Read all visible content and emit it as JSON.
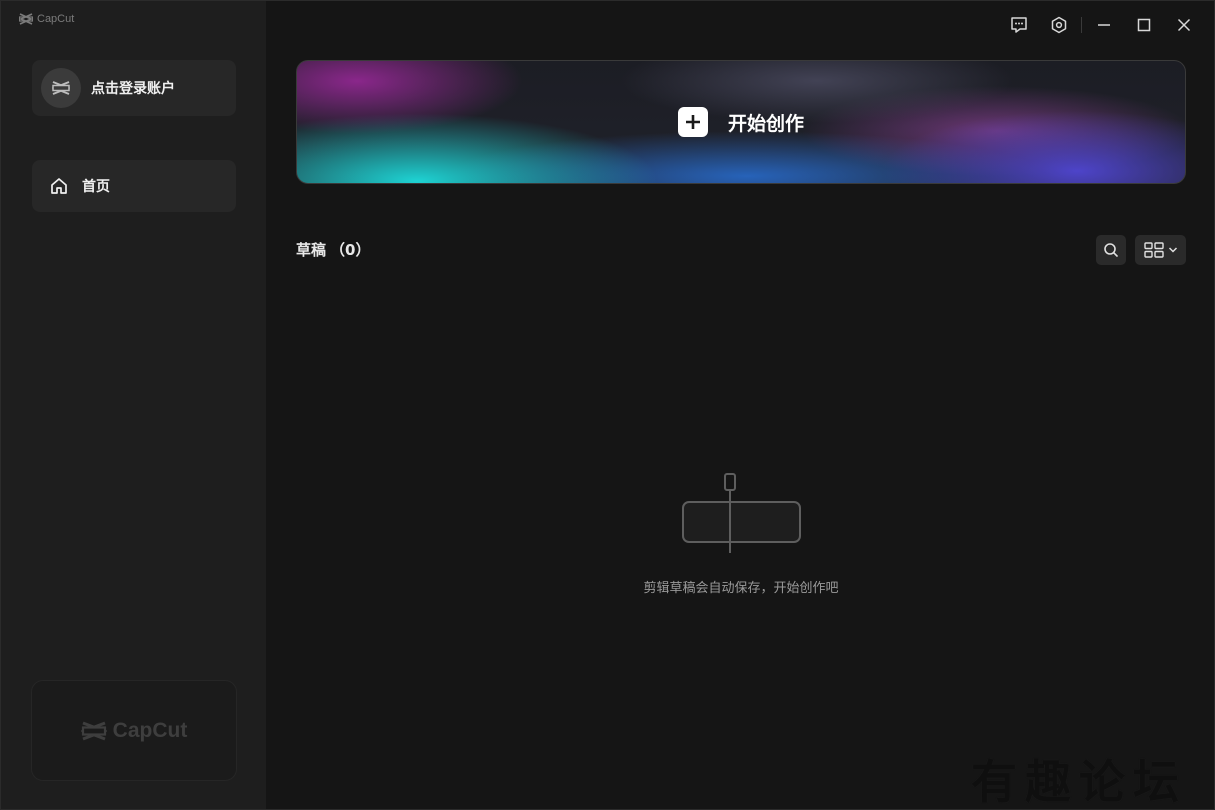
{
  "app": {
    "brand": "CapCut"
  },
  "sidebar": {
    "login_label": "点击登录账户",
    "nav": [
      {
        "label": "首页",
        "icon": "home-icon"
      }
    ],
    "brand_card_text": "CapCut"
  },
  "titlebar": {
    "icons": [
      "feedback-icon",
      "settings-icon",
      "minimize-icon",
      "maximize-icon",
      "close-icon"
    ]
  },
  "main": {
    "create_label": "开始创作",
    "drafts_title": "草稿",
    "drafts_count": "（0）",
    "empty_message": "剪辑草稿会自动保存，开始创作吧"
  },
  "watermark": "有趣论坛",
  "colors": {
    "sidebar_bg": "#1e1e1e",
    "main_bg": "#151515",
    "card_bg": "#272727",
    "text_primary": "#f0f0f0",
    "text_muted": "#9a9a9a"
  }
}
